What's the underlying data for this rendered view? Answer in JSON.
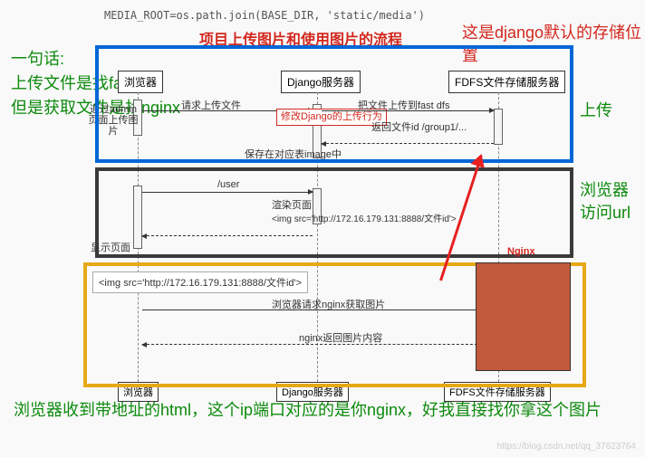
{
  "code_line": "MEDIA_ROOT=os.path.join(BASE_DIR, 'static/media')",
  "title_cn": "项目上传图片和使用图片的流程",
  "annotations": {
    "left": "一句话:\n上传文件是找fastdfs\n但是获取文件是找nginx",
    "right_top": "这是django默认的存储位置",
    "upload": "上传",
    "browser_visit": "浏览器访问url",
    "bottom": "浏览器收到带地址的html，这个ip端口对应的是你nginx，好我直接找你拿这个图片"
  },
  "actors": {
    "a1": "浏览器",
    "a2": "Django服务器",
    "a3": "FDFS文件存储服务器"
  },
  "messages": {
    "m1": "通过admin页面上传图片",
    "m2": "请求上传文件",
    "m3": "修改Django的上传行为",
    "m4": "把文件上传到fast dfs",
    "m5": "返回文件id /group1/...",
    "m6": "保存在对应表image中",
    "m7": "/user",
    "m8": "渲染页面",
    "m8_code": "<img src='http://172.16.179.131:8888/文件id'>",
    "m9": "显示页面",
    "m10": "浏览器请求nginx获取图片",
    "m11": "nginx返回图片内容"
  },
  "nginx_label": "Nginx",
  "img_src_sample": "<img src='http://172.16.179.131:8888/文件id'>",
  "watermark": "https://blog.csdn.net/qq_37623764"
}
